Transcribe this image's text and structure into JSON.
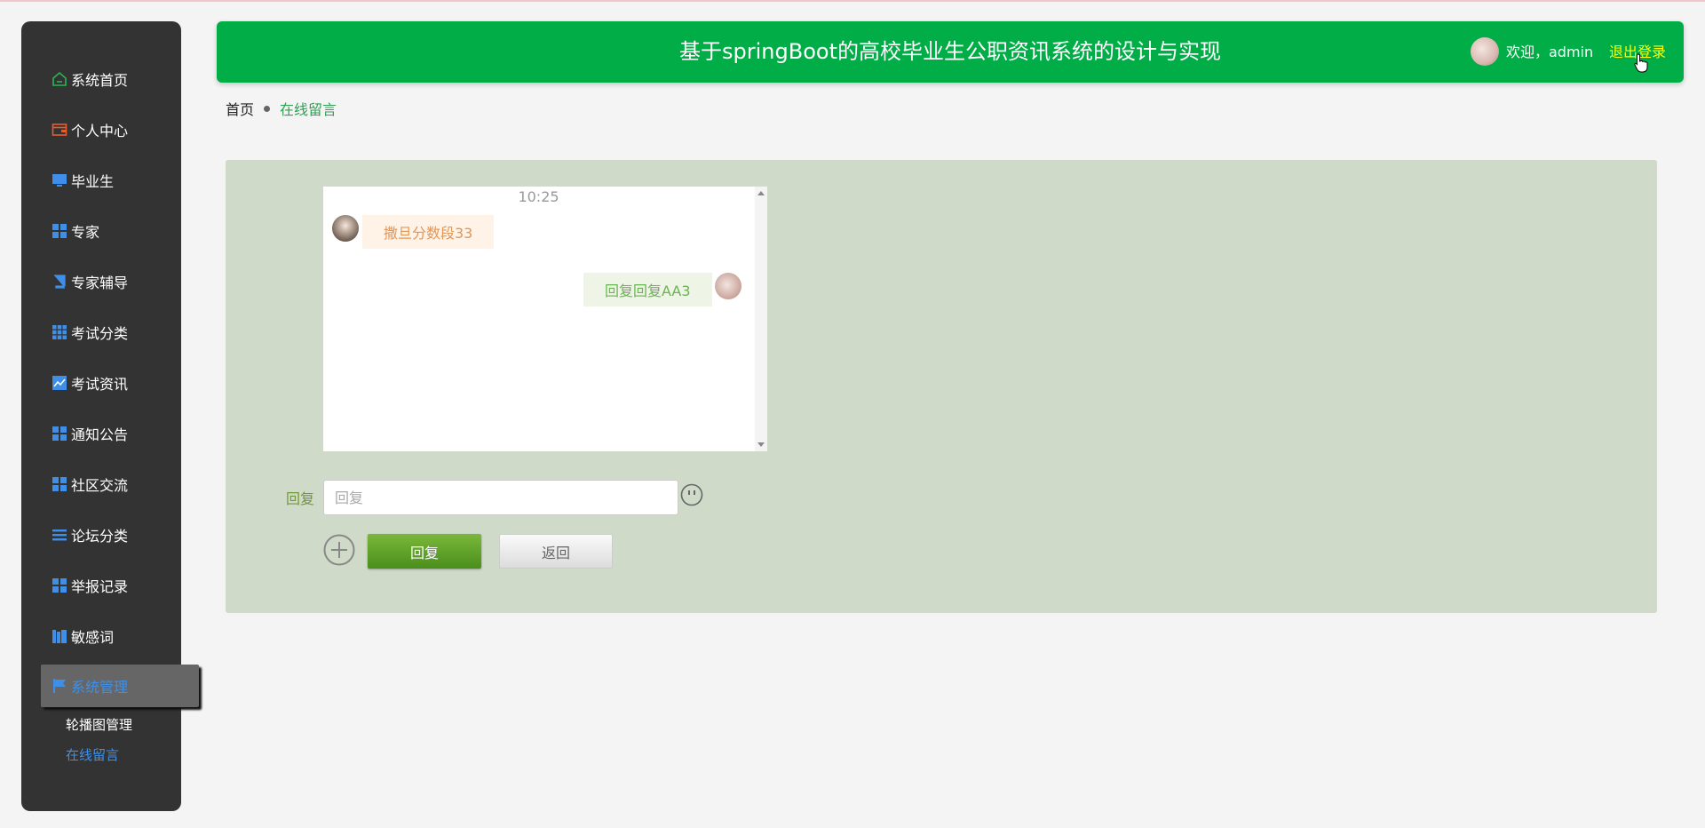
{
  "app": {
    "title": "基于springBoot的高校毕业生公职资讯系统的设计与实现",
    "welcome": "欢迎，admin",
    "logout": "退出登录",
    "header_color": "#00ad46",
    "logout_color": "#ffff00"
  },
  "sidebar": {
    "items": [
      {
        "label": "系统首页",
        "icon": "home-icon"
      },
      {
        "label": "个人中心",
        "icon": "wallet-icon"
      },
      {
        "label": "毕业生",
        "icon": "monitor-icon"
      },
      {
        "label": "专家",
        "icon": "grid-icon"
      },
      {
        "label": "专家辅导",
        "icon": "book-icon"
      },
      {
        "label": "考试分类",
        "icon": "grid9-icon"
      },
      {
        "label": "考试资讯",
        "icon": "chart-icon"
      },
      {
        "label": "通知公告",
        "icon": "grid-icon"
      },
      {
        "label": "社区交流",
        "icon": "grid-icon"
      },
      {
        "label": "论坛分类",
        "icon": "list-icon"
      },
      {
        "label": "举报记录",
        "icon": "grid-icon"
      },
      {
        "label": "敏感词",
        "icon": "books-icon"
      },
      {
        "label": "系统管理",
        "icon": "flag-icon",
        "active": true
      }
    ],
    "submenu": [
      {
        "label": "轮播图管理"
      },
      {
        "label": "在线留言",
        "current": true
      }
    ],
    "accent_color": "#3f8fe8"
  },
  "breadcrumb": {
    "home": "首页",
    "current": "在线留言"
  },
  "chat": {
    "time": "10:25",
    "messages": [
      {
        "side": "left",
        "text": "撒旦分数段33"
      },
      {
        "side": "right",
        "text": "回复回复AA3"
      }
    ]
  },
  "reply": {
    "label": "回复",
    "placeholder": "回复",
    "value": "",
    "submit_label": "回复",
    "back_label": "返回"
  }
}
